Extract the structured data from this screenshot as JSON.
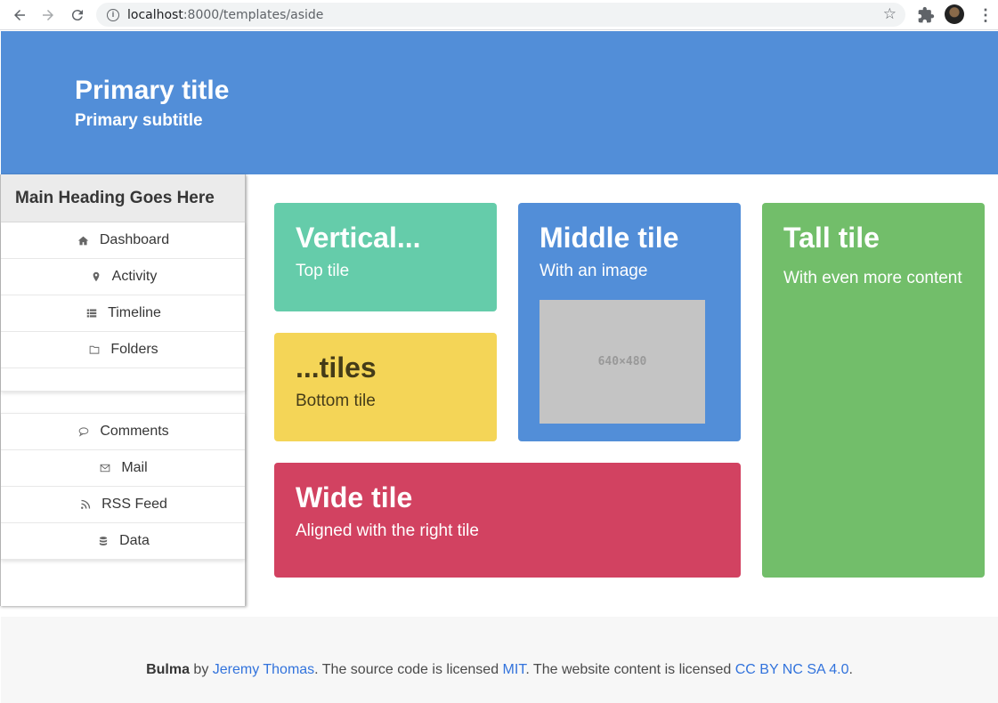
{
  "browser": {
    "url_host": "localhost",
    "url_path": ":8000/templates/aside"
  },
  "hero": {
    "title": "Primary title",
    "subtitle": "Primary subtitle"
  },
  "aside": {
    "heading": "Main Heading Goes Here",
    "items_top": [
      {
        "label": "Dashboard",
        "icon": "home-icon"
      },
      {
        "label": "Activity",
        "icon": "map-marker-icon"
      },
      {
        "label": "Timeline",
        "icon": "list-icon"
      },
      {
        "label": "Folders",
        "icon": "folder-icon"
      }
    ],
    "items_bottom": [
      {
        "label": "Comments",
        "icon": "comment-icon"
      },
      {
        "label": "Mail",
        "icon": "envelope-icon"
      },
      {
        "label": "RSS Feed",
        "icon": "rss-icon"
      },
      {
        "label": "Data",
        "icon": "database-icon"
      }
    ]
  },
  "tiles": {
    "top": {
      "title": "Vertical...",
      "subtitle": "Top tile",
      "color": "#65ccaa"
    },
    "bottom": {
      "title": "...tiles",
      "subtitle": "Bottom tile",
      "color": "#f4d557"
    },
    "middle": {
      "title": "Middle tile",
      "subtitle": "With an image",
      "image_label": "640×480",
      "color": "#528ed8"
    },
    "tall": {
      "title": "Tall tile",
      "subtitle": "With even more content",
      "color": "#72be6a"
    },
    "wide": {
      "title": "Wide tile",
      "subtitle": "Aligned with the right tile",
      "color": "#d24261"
    }
  },
  "footer": {
    "brand": "Bulma",
    "by": " by ",
    "author": "Jeremy Thomas",
    "source_text": ". The source code is licensed ",
    "license_code": "MIT",
    "content_text": ". The website content is licensed ",
    "license_content": "CC BY NC SA 4.0",
    "end": "."
  }
}
